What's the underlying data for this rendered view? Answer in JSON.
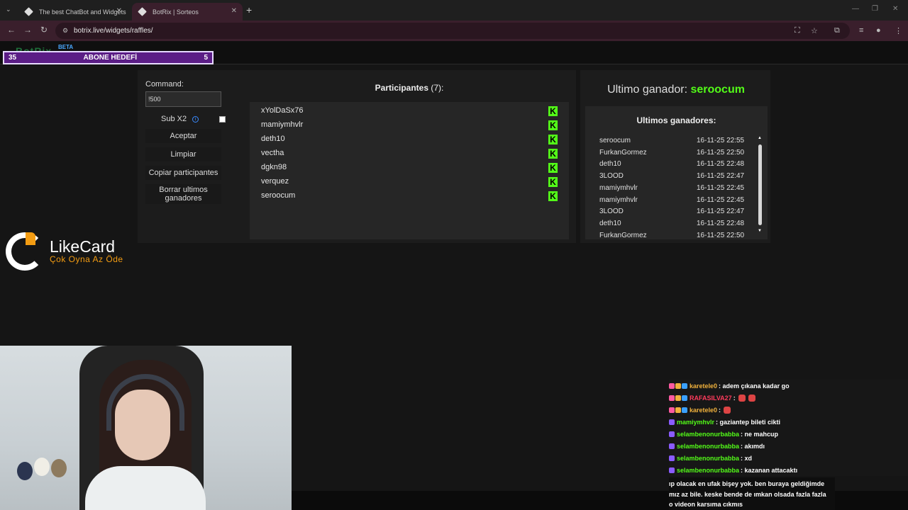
{
  "browser": {
    "tabs": [
      {
        "title": "The best ChatBot and Widgets"
      },
      {
        "title": "BotRix | Sorteos"
      }
    ],
    "url": "botrix.live/widgets/raffles/"
  },
  "overlay": {
    "logo_beta": "BETA",
    "abone": {
      "left": "35",
      "title": "ABONE HEDEFİ",
      "right": "5"
    }
  },
  "raffle": {
    "command_label": "Command:",
    "command_value": "!500",
    "sub_label": "Sub X2",
    "buttons": {
      "accept": "Aceptar",
      "clear": "Limpiar",
      "copy": "Copiar participantes",
      "delete_winners": "Borrar ultimos ganadores"
    },
    "participants_title": "Participantes",
    "participants_count": "(7):",
    "participants": [
      "xYolDaSx76",
      "mamiymhvlr",
      "deth10",
      "vectha",
      "dgkn98",
      "verquez",
      "seroocum"
    ],
    "last_winner_label": "Ultimo ganador:",
    "last_winner": "seroocum",
    "history_title": "Ultimos ganadores:",
    "history": [
      {
        "name": "seroocum",
        "date": "16-11-25 22:55"
      },
      {
        "name": "FurkanGormez",
        "date": "16-11-25 22:50"
      },
      {
        "name": "deth10",
        "date": "16-11-25 22:48"
      },
      {
        "name": "3LOOD",
        "date": "16-11-25 22:47"
      },
      {
        "name": "mamiymhvlr",
        "date": "16-11-25 22:45"
      },
      {
        "name": "mamiymhvlr",
        "date": "16-11-25 22:45"
      },
      {
        "name": "3LOOD",
        "date": "16-11-25 22:47"
      },
      {
        "name": "deth10",
        "date": "16-11-25 22:48"
      },
      {
        "name": "FurkanGormez",
        "date": "16-11-25 22:50"
      }
    ]
  },
  "sponsor": {
    "name": "LikeCard",
    "slogan": "Çok Oyna  Az Öde"
  },
  "chat": [
    {
      "user": "karetele0",
      "color": "#f0b13c",
      "msg": ": adem çıkana kadar go"
    },
    {
      "user": "RAFASILVA27",
      "color": "#ff3b5c",
      "msg": ":"
    },
    {
      "user": "karetele0",
      "color": "#f0b13c",
      "msg": ":"
    },
    {
      "user": "mamiymhvlr",
      "color": "#53fc18",
      "msg": ": gaziantep bileti cikti"
    },
    {
      "user": "selambenonurbabba",
      "color": "#53fc18",
      "msg": ": ne mahcup"
    },
    {
      "user": "selambenonurbabba",
      "color": "#53fc18",
      "msg": ": akımdı"
    },
    {
      "user": "selambenonurbabba",
      "color": "#53fc18",
      "msg": ": xd"
    },
    {
      "user": "selambenonurbabba",
      "color": "#53fc18",
      "msg": ": kazanan attacaktı"
    }
  ],
  "chat_bottom": [
    "ıp olacak en ufak bişey yok. ben buraya geldiğimde",
    "mız az bile. keske bende de ımkan olsada fazla fazla",
    "o videon karsıma cıkmıs"
  ],
  "colors": {
    "kick_green": "#53fc18",
    "accent_purple": "#5b1d86"
  }
}
